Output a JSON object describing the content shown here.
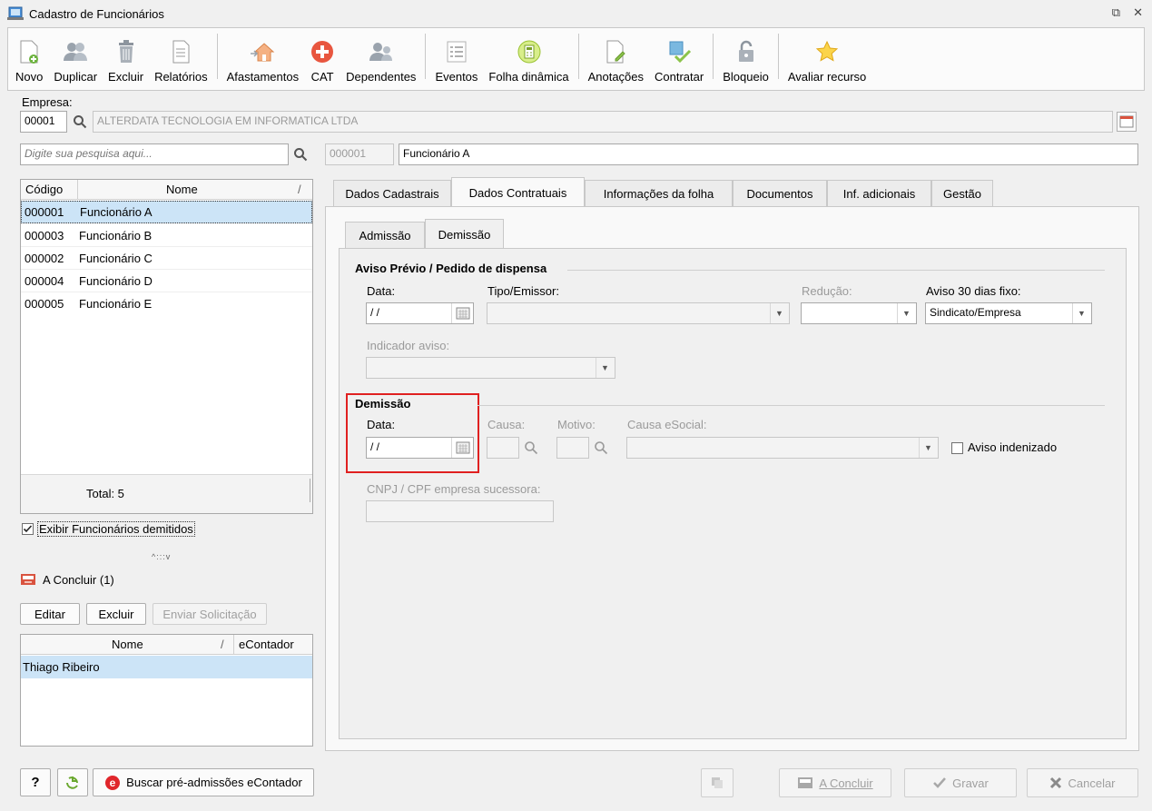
{
  "window": {
    "title": "Cadastro de Funcionários",
    "restore_glyph": "⧉",
    "close_glyph": "✕"
  },
  "toolbar": [
    {
      "label": "Novo",
      "icon": "new-doc-icon"
    },
    {
      "label": "Duplicar",
      "icon": "duplicate-users-icon"
    },
    {
      "label": "Excluir",
      "icon": "trash-icon"
    },
    {
      "label": "Relatórios",
      "icon": "report-icon"
    },
    {
      "label": "Afastamentos",
      "icon": "home-arrow-icon"
    },
    {
      "label": "CAT",
      "icon": "medical-cross-icon"
    },
    {
      "label": "Dependentes",
      "icon": "dependents-icon"
    },
    {
      "label": "Eventos",
      "icon": "list-icon"
    },
    {
      "label": "Folha dinâmica",
      "icon": "calculator-icon"
    },
    {
      "label": "Anotações",
      "icon": "notes-icon"
    },
    {
      "label": "Contratar",
      "icon": "hire-icon"
    },
    {
      "label": "Bloqueio",
      "icon": "lock-icon"
    },
    {
      "label": "Avaliar recurso",
      "icon": "star-icon"
    }
  ],
  "empresa": {
    "label": "Empresa:",
    "code": "00001",
    "name": "ALTERDATA TECNOLOGIA EM INFORMATICA LTDA"
  },
  "search": {
    "placeholder": "Digite sua pesquisa aqui..."
  },
  "employee_list": {
    "headers": {
      "code": "Código",
      "name": "Nome",
      "sort": "/"
    },
    "rows": [
      {
        "code": "000001",
        "name": "Funcionário A"
      },
      {
        "code": "000003",
        "name": "Funcionário B"
      },
      {
        "code": "000002",
        "name": "Funcionário C"
      },
      {
        "code": "000004",
        "name": "Funcionário D"
      },
      {
        "code": "000005",
        "name": "Funcionário E"
      }
    ],
    "total": "Total: 5"
  },
  "show_dismissed": {
    "label": "Exibir Funcionários demitidos",
    "checked": true
  },
  "splitter_glyph": "^:::v",
  "pending": {
    "title": "A Concluir (1)",
    "buttons": {
      "edit": "Editar",
      "delete": "Excluir",
      "send": "Enviar Solicitação"
    },
    "headers": {
      "name": "Nome",
      "sort": "/",
      "econtador": "eContador"
    },
    "rows": [
      {
        "name": "Thiago Ribeiro",
        "econtador": ""
      }
    ]
  },
  "selected": {
    "code": "000001",
    "name": "Funcionário A"
  },
  "tabs": [
    "Dados Cadastrais",
    "Dados Contratuais",
    "Informações da folha",
    "Documentos",
    "Inf. adicionais",
    "Gestão"
  ],
  "subtabs": [
    "Admissão",
    "Demissão"
  ],
  "aviso": {
    "group": "Aviso Prévio / Pedido de dispensa",
    "data_label": "Data:",
    "data_value": " /  /",
    "tipo_label": "Tipo/Emissor:",
    "reducao_label": "Redução:",
    "aviso30_label": "Aviso 30 dias fixo:",
    "aviso30_value": "Sindicato/Empresa",
    "indicador_label": "Indicador aviso:"
  },
  "demissao": {
    "group": "Demissão",
    "data_label": "Data:",
    "data_value": " /  /",
    "causa_label": "Causa:",
    "motivo_label": "Motivo:",
    "causa_esocial_label": "Causa eSocial:",
    "aviso_indenizado": "Aviso indenizado",
    "cnpj_label": "CNPJ / CPF empresa sucessora:"
  },
  "bottom": {
    "help": "?",
    "econtador_btn": "Buscar pré-admissões eContador",
    "concluir": "A Concluir",
    "gravar": "Gravar",
    "cancelar": "Cancelar"
  }
}
